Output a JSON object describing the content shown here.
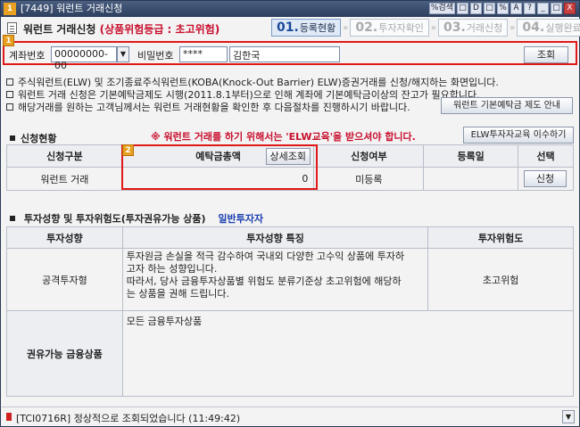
{
  "window": {
    "app_number": "1",
    "title": "[7449] 워런트 거래신청"
  },
  "titlebar_buttons": [
    "%검색",
    "□",
    "D",
    "□",
    "%",
    "A",
    "?",
    "_",
    "□",
    "X"
  ],
  "header": {
    "screen_title": "워런트 거래신청",
    "risk_grade": "(상품위험등급 : 초고위험)"
  },
  "steps": [
    {
      "num": "01.",
      "label": "등록현황"
    },
    {
      "num": "02.",
      "label": "투자자확인"
    },
    {
      "num": "03.",
      "label": "거래신청"
    },
    {
      "num": "04.",
      "label": "실행완료"
    }
  ],
  "markers": {
    "m1": "1",
    "m2": "2"
  },
  "account": {
    "account_label": "계좌번호",
    "account_value": "00000000-00",
    "password_label": "비밀번호",
    "password_value": "****",
    "holder_name": "김한국",
    "lookup_button": "조회"
  },
  "info_lines": [
    "주식워런트(ELW) 및 조기종료주식워런트(KOBA(Knock-Out Barrier) ELW)증권거래를 신청/해지하는 화면입니다.",
    "워런트 거래 신청은 기본예탁금제도 시행(2011.8.1부터)으로 인해 계좌에 기본예탁금이상의 잔고가 필요합니다.",
    "해당거래를 원하는 고객님께서는 워런트 거래현황을 확인한 후 다음절차를 진행하시기 바랍니다."
  ],
  "deposit_guide_button": "워런트 기본예탁금 제도 안내",
  "application_section": {
    "title": "신청현황",
    "notice": "※ 워런트 거래를 하기 위해서는 'ELW교육'을 받으셔야 합니다.",
    "edu_button": "ELW투자자교육 이수하기",
    "columns": {
      "type": "신청구분",
      "deposit": "예탁금총액",
      "detail_button": "상세조회",
      "status": "신청여부",
      "date": "등록일",
      "select": "선택"
    },
    "row": {
      "type": "워런트 거래",
      "deposit": "0",
      "status": "미등록",
      "date": "",
      "apply_button": "신청"
    }
  },
  "investment_section": {
    "title": "투자성향 및 투자위험도(투자권유가능 상품)",
    "investor_type": "일반투자자",
    "columns": {
      "tendency": "투자성향",
      "feature": "투자성향 특징",
      "risk": "투자위험도"
    },
    "row": {
      "tendency": "공격투자형",
      "feature_lines": [
        "투자원금 손실을 적극 감수하여 국내외 다양한 고수익 상품에 투자하",
        "고자 하는 성향입니다.",
        "따라서, 당사 금융투자상품별 위험도 분류기준상 초고위험에 해당하",
        "는 상품을 권해 드립니다."
      ],
      "risk": "초고위험"
    },
    "recommend_label": "권유가능 금융상품",
    "recommend_value": "모든 금융투자상품"
  },
  "status_bar": {
    "message": "[TCI0716R] 정상적으로 조회되었습니다 (11:49:42)"
  },
  "colors": {
    "accent_red": "#c8102e",
    "marker_orange": "#e8a020",
    "investor_blue": "#1a3fb0"
  }
}
